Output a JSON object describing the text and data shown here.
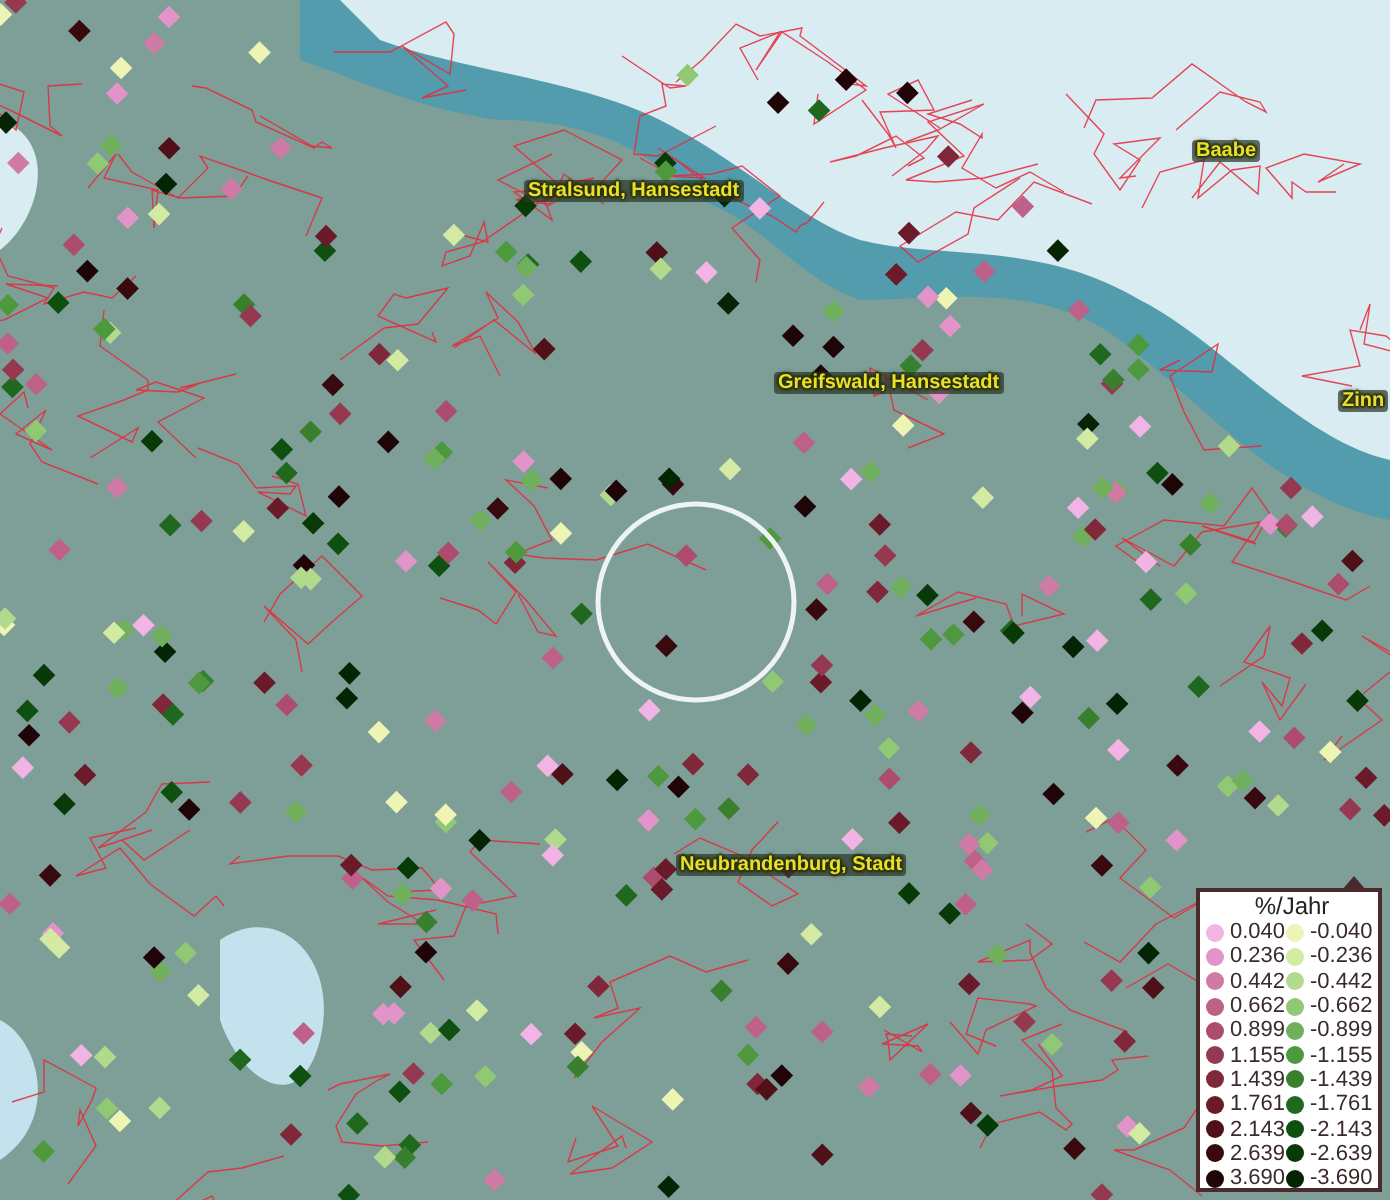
{
  "map": {
    "places": [
      {
        "name": "Stralsund, Hansestadt"
      },
      {
        "name": "Greifswald, Hansestadt"
      },
      {
        "name": "Baabe"
      },
      {
        "name": "Zinn"
      },
      {
        "name": "Neubrandenburg, Stadt"
      }
    ],
    "legend": {
      "title": "%/Jahr",
      "items": [
        {
          "label": "0.040",
          "color": "#f2b4e4"
        },
        {
          "label": "-0.040",
          "color": "#eef5b4"
        },
        {
          "label": "0.236",
          "color": "#e294c8"
        },
        {
          "label": "-0.236",
          "color": "#d2eaa2"
        },
        {
          "label": "0.442",
          "color": "#d07aa6"
        },
        {
          "label": "-0.442",
          "color": "#b2da8c"
        },
        {
          "label": "0.662",
          "color": "#be6088"
        },
        {
          "label": "-0.662",
          "color": "#90c874"
        },
        {
          "label": "0.899",
          "color": "#ae4c6e"
        },
        {
          "label": "-0.899",
          "color": "#70b05c"
        },
        {
          "label": "1.155",
          "color": "#963850"
        },
        {
          "label": "-1.155",
          "color": "#4e983e"
        },
        {
          "label": "1.439",
          "color": "#80283a"
        },
        {
          "label": "-1.439",
          "color": "#38802e"
        },
        {
          "label": "1.761",
          "color": "#6a1a28"
        },
        {
          "label": "-1.761",
          "color": "#20681e"
        },
        {
          "label": "2.143",
          "color": "#501018"
        },
        {
          "label": "-2.143",
          "color": "#0e5010"
        },
        {
          "label": "2.639",
          "color": "#380a10"
        },
        {
          "label": "-2.639",
          "color": "#083a08"
        },
        {
          "label": "3.690",
          "color": "#200508"
        },
        {
          "label": "-3.690",
          "color": "#042404"
        }
      ]
    }
  }
}
